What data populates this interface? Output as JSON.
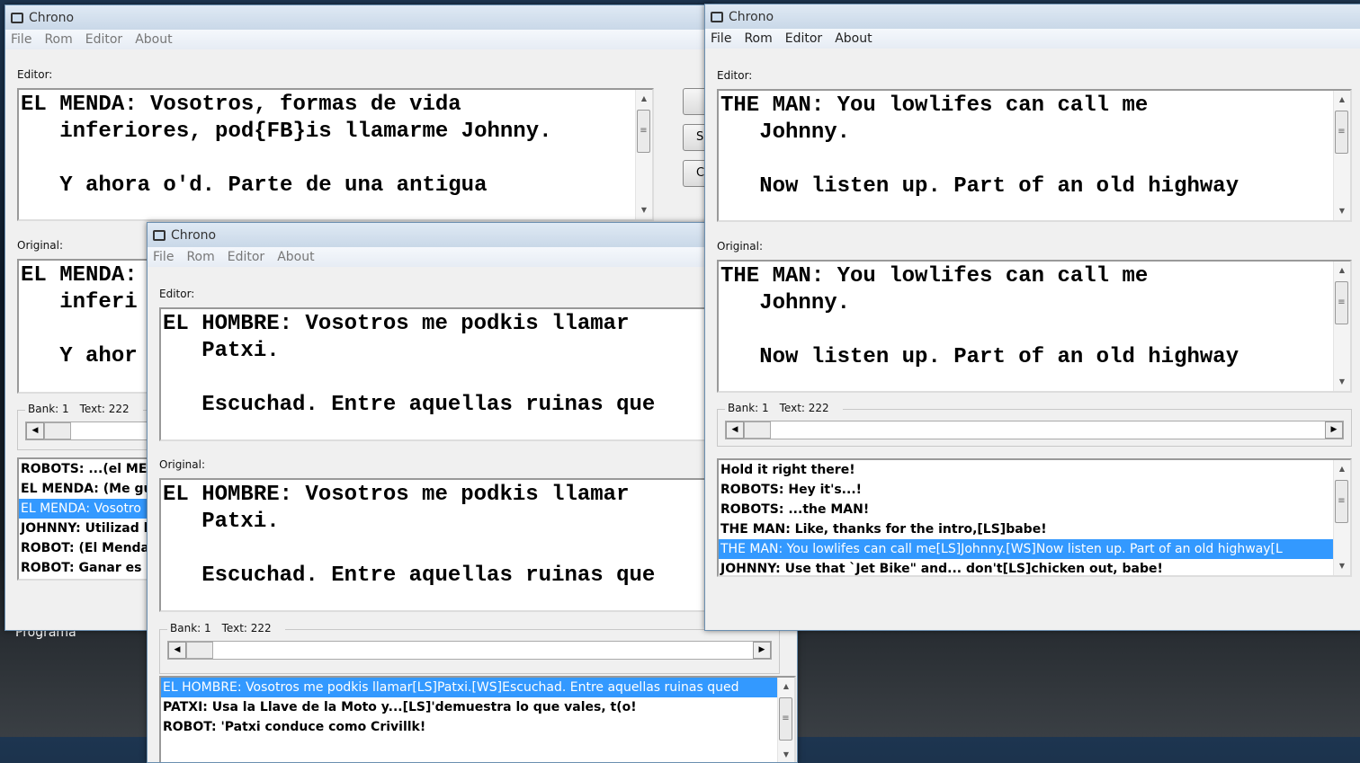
{
  "desktop": {
    "label": "Programa"
  },
  "windows": [
    {
      "title": "Chrono",
      "active": false,
      "menu": [
        "File",
        "Rom",
        "Editor",
        "About"
      ],
      "editor_label": "Editor:",
      "editor_lines": [
        "EL MENDA: Vosotros, formas de vida",
        "   inferiores, pod{FB}is llamarme Johnny.",
        "",
        "   Y ahora o'd. Parte de una antigua"
      ],
      "original_label": "Original:",
      "original_lines": [
        "EL MENDA:",
        "   inferi",
        "",
        "   Y ahor"
      ],
      "bank_label": "Bank: 1",
      "text_label": "Text: 222",
      "buttons": [
        "",
        "S",
        "C"
      ],
      "list_items": [
        "ROBOTS: ...(el MEN",
        "EL MENDA: (Me gus",
        "EL MENDA: Vosotro",
        "JOHNNY: Utilizad l",
        "ROBOT: (El Menda",
        "ROBOT: Ganar es lo"
      ],
      "selected_index": 2
    },
    {
      "title": "Chrono",
      "active": false,
      "menu": [
        "File",
        "Rom",
        "Editor",
        "About"
      ],
      "editor_label": "Editor:",
      "editor_lines": [
        "EL HOMBRE: Vosotros me podkis llamar",
        "   Patxi.",
        "",
        "   Escuchad. Entre aquellas ruinas que"
      ],
      "original_label": "Original:",
      "original_lines": [
        "EL HOMBRE: Vosotros me podkis llamar",
        "   Patxi.",
        "",
        "   Escuchad. Entre aquellas ruinas que"
      ],
      "bank_label": "Bank: 1",
      "text_label": "Text: 222",
      "list_items": [
        "EL HOMBRE: Vosotros me podkis llamar[LS]Patxi.[WS]Escuchad. Entre aquellas ruinas qued",
        "PATXI: Usa la Llave de la Moto y...[LS]'demuestra lo que vales, t(o!",
        "ROBOT: 'Patxi conduce como Crivillk!"
      ],
      "selected_index": 0
    },
    {
      "title": "Chrono",
      "active": true,
      "menu": [
        "File",
        "Rom",
        "Editor",
        "About"
      ],
      "editor_label": "Editor:",
      "editor_lines": [
        "THE MAN: You lowlifes can call me",
        "   Johnny.",
        "",
        "   Now listen up. Part of an old highway"
      ],
      "original_label": "Original:",
      "original_lines": [
        "THE MAN: You lowlifes can call me",
        "   Johnny.",
        "",
        "   Now listen up. Part of an old highway"
      ],
      "bank_label": "Bank: 1",
      "text_label": "Text: 222",
      "list_items": [
        "Hold it right there!",
        "ROBOTS: Hey it's...!",
        "ROBOTS: ...the MAN!",
        "THE MAN: Like, thanks for the intro,[LS]babe!",
        "THE MAN: You lowlifes can call me[LS]Johnny.[WS]Now listen up. Part of an old highway[L",
        "JOHNNY: Use that `Jet Bike\" and... don't[LS]chicken out, babe!"
      ],
      "selected_index": 4
    }
  ]
}
